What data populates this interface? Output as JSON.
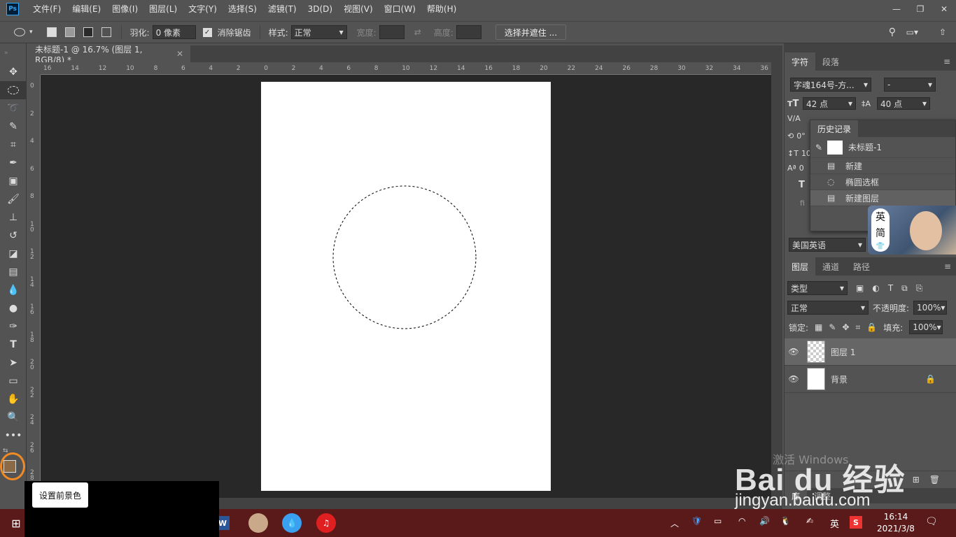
{
  "app": {
    "logo": "Ps"
  },
  "menu": [
    "文件(F)",
    "编辑(E)",
    "图像(I)",
    "图层(L)",
    "文字(Y)",
    "选择(S)",
    "滤镜(T)",
    "3D(D)",
    "视图(V)",
    "窗口(W)",
    "帮助(H)"
  ],
  "options": {
    "feather_label": "羽化:",
    "feather_value": "0 像素",
    "antialias_label": "消除锯齿",
    "style_label": "样式:",
    "style_value": "正常",
    "width_label": "宽度:",
    "height_label": "高度:",
    "select_mask_button": "选择并遮住 ..."
  },
  "document": {
    "tab_title": "未标题-1 @ 16.7% (图层 1, RGB/8) *"
  },
  "ruler_top": [
    "16",
    "14",
    "12",
    "10",
    "8",
    "6",
    "4",
    "2",
    "0",
    "2",
    "4",
    "6",
    "8",
    "10",
    "12",
    "14",
    "16",
    "18",
    "20",
    "22",
    "24",
    "26",
    "28",
    "30",
    "32",
    "34",
    "36"
  ],
  "ruler_left": [
    "0",
    "2",
    "4",
    "6",
    "8",
    "10",
    "12",
    "14",
    "16",
    "18",
    "20",
    "22",
    "24",
    "26",
    "28"
  ],
  "character_panel": {
    "tabs": [
      "字符",
      "段落"
    ],
    "font_family": "字魂164号-方...",
    "font_style": "-",
    "size": "42 点",
    "leading": "40 点",
    "language": "美国英语",
    "rows": [
      "0°",
      "10",
      "0"
    ]
  },
  "history_panel": {
    "title": "历史记录",
    "snapshot": "未标题-1",
    "items": [
      "新建",
      "椭圆选框",
      "新建图层"
    ]
  },
  "ime_badge": {
    "chars": [
      "英",
      "简"
    ]
  },
  "layers_panel": {
    "tabs": [
      "图层",
      "通道",
      "路径"
    ],
    "filter": "类型",
    "blend_mode": "正常",
    "opacity_label": "不透明度:",
    "opacity_value": "100%",
    "lock_label": "锁定:",
    "fill_label": "填充:",
    "fill_value": "100%",
    "layers": [
      {
        "name": "图层 1",
        "selected": true
      },
      {
        "name": "背景",
        "locked": true
      }
    ],
    "bottom_tabs": [
      "库",
      "调整"
    ]
  },
  "tooltip": {
    "text": "设置前景色"
  },
  "colors": {
    "foreground": "#8b6b45",
    "highlight_ring": "#f08a24",
    "taskbar": "#5b1a1a"
  },
  "taskbar": {
    "time": "16:14",
    "date": "2021/3/8",
    "ime": "英"
  },
  "watermark": {
    "brand": "Bai du 经验",
    "url": "jingyan.baidu.com",
    "activate_text": "激活 Windows"
  }
}
